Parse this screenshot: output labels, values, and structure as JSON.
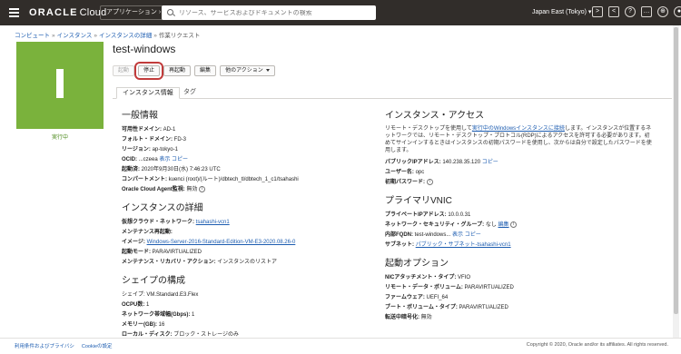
{
  "topbar": {
    "logo_brand": "ORACLE",
    "logo_product": "Cloud",
    "applications_label": "アプリケーション",
    "search_placeholder": "リソース、サービスおよびドキュメントの検索",
    "region": "Japan East (Tokyo)",
    "icons": [
      "cloud-shell-icon",
      "code-editor-icon",
      "help-icon",
      "chat-icon",
      "language-icon",
      "profile-icon"
    ]
  },
  "breadcrumb": {
    "items": [
      "コンピュート",
      "インスタンス",
      "インスタンスの詳細",
      "作業リクエスト"
    ]
  },
  "instance": {
    "name": "test-windows",
    "status": "実行中",
    "status_color": "#7ab23c"
  },
  "actions": {
    "start": "起動",
    "stop": "停止",
    "reboot": "再起動",
    "edit": "編集",
    "more": "他のアクション"
  },
  "tabs": {
    "info": "インスタンス情報",
    "tags": "タグ"
  },
  "general": {
    "title": "一般情報",
    "ad_label": "可用性ドメイン:",
    "ad_value": "AD-1",
    "fd_label": "フォルト・ドメイン:",
    "fd_value": "FD-3",
    "region_label": "リージョン:",
    "region_value": "ap-tokyo-1",
    "ocid_label": "OCID:",
    "ocid_value": "...czeea",
    "show": "表示",
    "copy": "コピー",
    "launched_label": "起動済:",
    "launched_value": "2020年9月30日(水) 7:46:23 UTC",
    "compartment_label": "コンパートメント:",
    "compartment_value": "kuenci (root)/(ルート)/dbtech_tl/dbtech_1_c1/tsahashi",
    "agent_label": "Oracle Cloud Agent監視:",
    "agent_value": "無効"
  },
  "details": {
    "title": "インスタンスの詳細",
    "vcn_label": "仮想クラウド・ネットワーク:",
    "vcn_value": "tsahashi-vcn1",
    "maintenance_label": "メンテナンス再起動:",
    "image_label": "イメージ:",
    "image_value": "Windows-Server-2016-Standard-Edition-VM-E3-2020.08.26-0",
    "launch_mode_label": "起動モード:",
    "launch_mode_value": "PARAVIRTUALIZED",
    "recovery_label": "メンテナンス・リカバリ・アクション:",
    "recovery_value": "インスタンスのリストア"
  },
  "shape": {
    "title": "シェイプの構成",
    "shape_label": "シェイプ:",
    "shape_value": "VM.Standard.E3.Flex",
    "ocpu_label": "OCPU数:",
    "ocpu_value": "1",
    "bandwidth_label": "ネットワーク帯域幅(Gbps):",
    "bandwidth_value": "1",
    "memory_label": "メモリー(GB):",
    "memory_value": "16",
    "local_disk_label": "ローカル・ディスク:",
    "local_disk_value": "ブロック・ストレージのみ"
  },
  "access": {
    "title": "インスタンス・アクセス",
    "desc_pre": "リモート・デスクトップを使用して",
    "desc_link": "実行中のWindowsインスタンスに接続",
    "desc_post": "します。インスタンスが位置するネットワークでは、リモート・デスクトップ・プロトコル(RDP)によるアクセスを許可する必要があります。初めてサインインするときはインスタンスの初期パスワードを使用し、次からは自分で設定したパスワードを使用します。",
    "public_ip_label": "パブリックIPアドレス:",
    "public_ip_value": "140.238.35.120",
    "copy": "コピー",
    "user_label": "ユーザー名:",
    "user_value": "opc",
    "password_label": "初期パスワード:"
  },
  "vnic": {
    "title": "プライマリVNIC",
    "private_ip_label": "プライベートIPアドレス:",
    "private_ip_value": "10.0.0.31",
    "nsg_label": "ネットワーク・セキュリティ・グループ:",
    "nsg_value": "なし",
    "nsg_edit": "編集",
    "fqdn_label": "内部FQDN:",
    "fqdn_value": "test-windows...",
    "show": "表示",
    "copy": "コピー",
    "subnet_label": "サブネット:",
    "subnet_value": "パブリック・サブネット-tsahashi-vcn1"
  },
  "launch_options": {
    "title": "起動オプション",
    "nic_label": "NICアタッチメント・タイプ:",
    "nic_value": "VFIO",
    "remote_volume_label": "リモート・データ・ボリューム:",
    "remote_volume_value": "PARAVIRTUALIZED",
    "firmware_label": "ファームウェア:",
    "firmware_value": "UEFI_64",
    "boot_volume_label": "ブート・ボリューム・タイプ:",
    "boot_volume_value": "PARAVIRTUALIZED",
    "encryption_label": "転送中暗号化:",
    "encryption_value": "無効"
  },
  "footer": {
    "terms": "利用条件およびプライバシ",
    "cookie": "Cookieの設定",
    "copyright": "Copyright © 2020, Oracle and/or its affiliates. All rights reserved."
  },
  "colors": {
    "topbar": "#312d2a",
    "link": "#1c5cb0",
    "highlight": "#c13b3b"
  }
}
